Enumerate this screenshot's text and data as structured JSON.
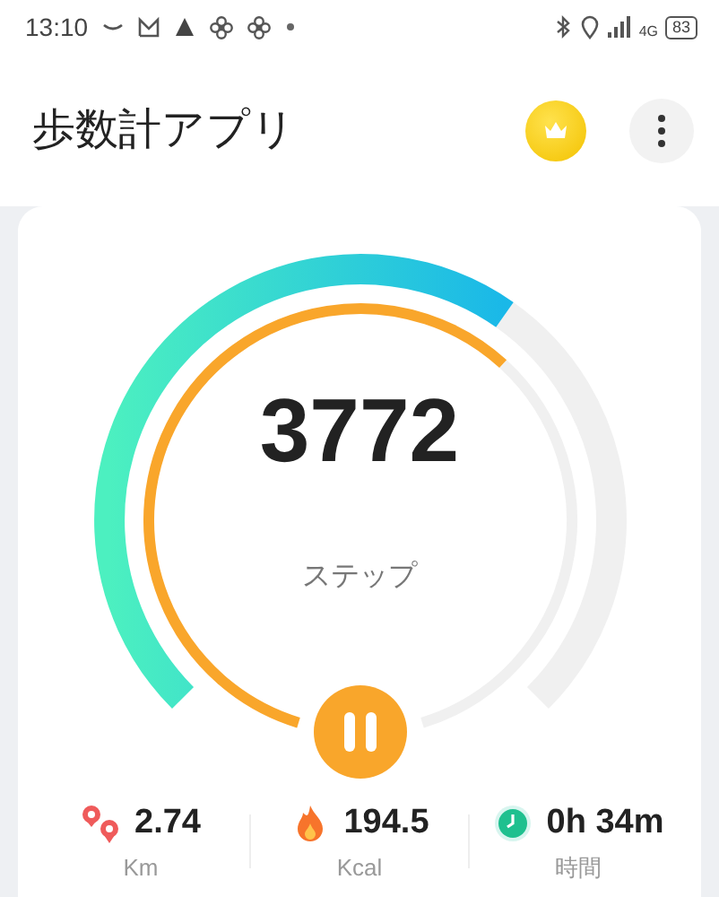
{
  "status_bar": {
    "time": "13:10",
    "network": "4G",
    "battery": "83"
  },
  "app_bar": {
    "title": "歩数計アプリ"
  },
  "gauge": {
    "steps": "3772",
    "unit": "ステップ",
    "paused": false
  },
  "stats": [
    {
      "kind": "distance",
      "value": "2.74",
      "unit": "Km"
    },
    {
      "kind": "calories",
      "value": "194.5",
      "unit": "Kcal"
    },
    {
      "kind": "time",
      "value": "0h 34m",
      "unit": "時間"
    }
  ]
}
